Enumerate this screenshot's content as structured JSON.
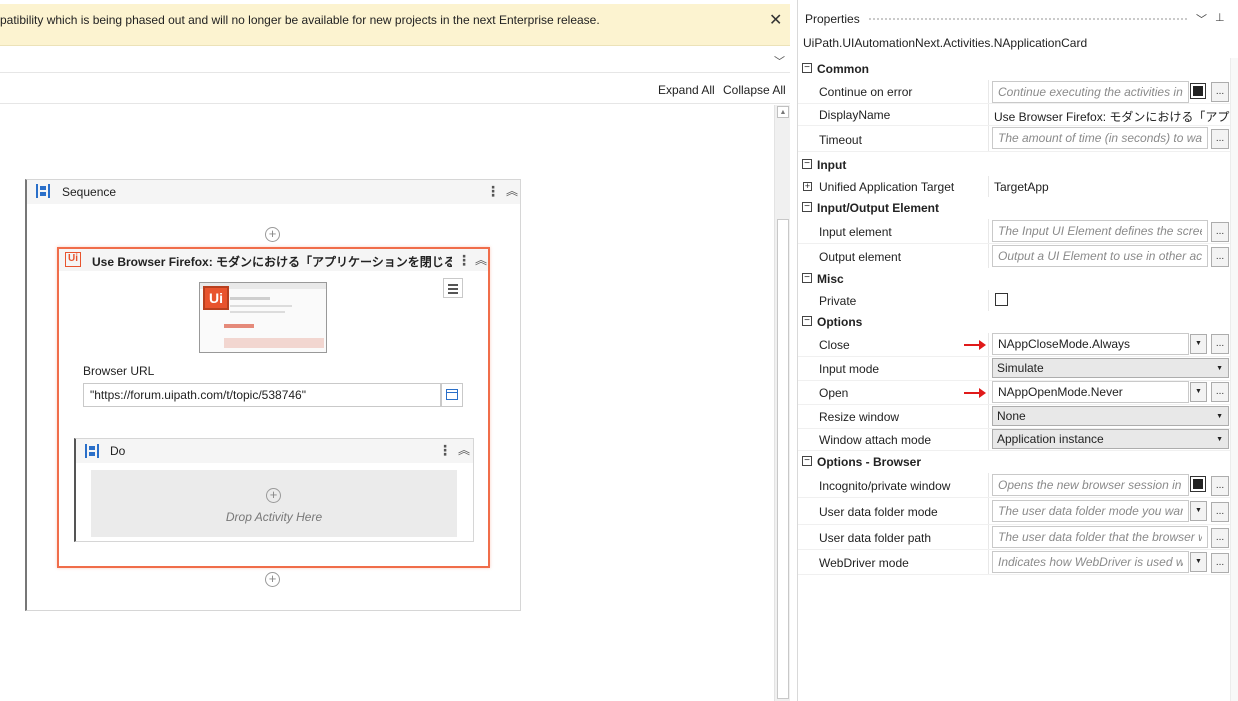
{
  "warning": {
    "text": "patibility which is being phased out and will no longer be available for new projects in the next Enterprise release.",
    "close_glyph": "✕"
  },
  "toolbar": {
    "expand_all": "Expand All",
    "collapse_all": "Collapse All"
  },
  "sequence": {
    "title": "Sequence"
  },
  "browser_card": {
    "title": "Use Browser Firefox: モダンにおける「アプリケーションを閉じる」アクティ...",
    "logo_text": "Ui",
    "url_label": "Browser URL",
    "url_value": "\"https://forum.uipath.com/t/topic/538746\""
  },
  "do_card": {
    "title": "Do",
    "drop_label": "Drop Activity Here"
  },
  "properties": {
    "title": "Properties",
    "type_name": "UiPath.UIAutomationNext.Activities.NApplicationCard",
    "categories": {
      "common": "Common",
      "input": "Input",
      "io_element": "Input/Output Element",
      "misc": "Misc",
      "options": "Options",
      "options_browser": "Options - Browser"
    },
    "rows": {
      "continue_on_error": {
        "name": "Continue on error",
        "placeholder": "Continue executing the activities in"
      },
      "display_name": {
        "name": "DisplayName",
        "value": "Use Browser Firefox: モダンにおける「アプリケーシ"
      },
      "timeout": {
        "name": "Timeout",
        "placeholder": "The amount of time (in seconds) to wai"
      },
      "target": {
        "name": "Unified Application Target",
        "value": "TargetApp"
      },
      "input_element": {
        "name": "Input element",
        "placeholder": "The Input UI Element defines the scree"
      },
      "output_element": {
        "name": "Output element",
        "placeholder": "Output a UI Element to use in other act"
      },
      "private": {
        "name": "Private"
      },
      "close": {
        "name": "Close",
        "value": "NAppCloseMode.Always"
      },
      "input_mode": {
        "name": "Input mode",
        "value": "Simulate"
      },
      "open": {
        "name": "Open",
        "value": "NAppOpenMode.Never"
      },
      "resize_window": {
        "name": "Resize window",
        "value": "None"
      },
      "window_attach_mode": {
        "name": "Window attach mode",
        "value": "Application instance"
      },
      "incognito": {
        "name": "Incognito/private window",
        "placeholder": "Opens the new browser session in i"
      },
      "user_data_folder_mode": {
        "name": "User data folder mode",
        "placeholder": "The user data folder mode you war"
      },
      "user_data_folder_path": {
        "name": "User data folder path",
        "placeholder": "The user data folder that the browser w"
      },
      "webdriver_mode": {
        "name": "WebDriver mode",
        "placeholder": "Indicates how WebDriver is used wi"
      }
    }
  },
  "colors": {
    "accent": "#f06d4a",
    "warning_bg": "#fcf3d0",
    "arrow": "#e01a1a",
    "sequence_icon": "#2a6fc9"
  }
}
